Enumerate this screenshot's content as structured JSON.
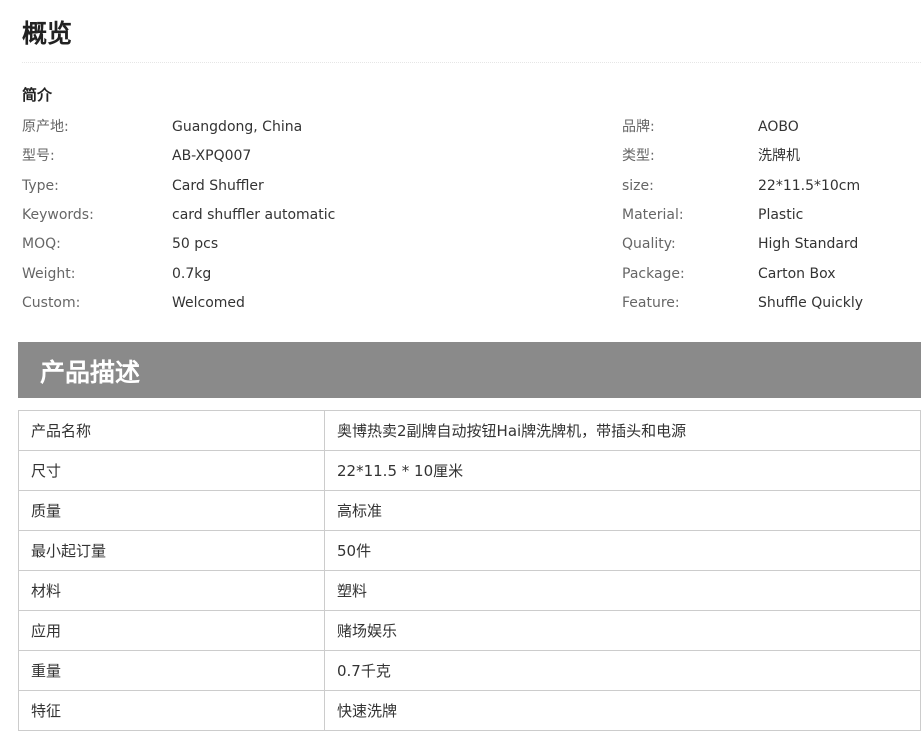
{
  "overview": {
    "title": "概览"
  },
  "intro": {
    "title": "简介",
    "left": [
      {
        "label": "原产地:",
        "value": "Guangdong, China"
      },
      {
        "label": "型号:",
        "value": "AB-XPQ007"
      },
      {
        "label": "Type:",
        "value": "Card Shuffler"
      },
      {
        "label": "Keywords:",
        "value": "card shuffler automatic"
      },
      {
        "label": "MOQ:",
        "value": "50 pcs"
      },
      {
        "label": "Weight:",
        "value": "0.7kg"
      },
      {
        "label": "Custom:",
        "value": "Welcomed"
      }
    ],
    "right": [
      {
        "label": "品牌:",
        "value": "AOBO"
      },
      {
        "label": "类型:",
        "value": "洗牌机"
      },
      {
        "label": "size:",
        "value": "22*11.5*10cm"
      },
      {
        "label": "Material:",
        "value": "Plastic"
      },
      {
        "label": "Quality:",
        "value": "High Standard"
      },
      {
        "label": "Package:",
        "value": "Carton Box"
      },
      {
        "label": "Feature:",
        "value": "Shuffle Quickly"
      }
    ]
  },
  "description": {
    "title": "产品描述",
    "rows": [
      {
        "label": "产品名称",
        "value": "奥博热卖2副牌自动按钮Hai牌洗牌机，带插头和电源"
      },
      {
        "label": "尺寸",
        "value": "22*11.5 * 10厘米"
      },
      {
        "label": "质量",
        "value": "高标准"
      },
      {
        "label": "最小起订量",
        "value": "50件"
      },
      {
        "label": "材料",
        "value": "塑料"
      },
      {
        "label": "应用",
        "value": "赌场娱乐"
      },
      {
        "label": "重量",
        "value": "0.7千克"
      },
      {
        "label": "特征",
        "value": "快速洗牌"
      }
    ]
  }
}
